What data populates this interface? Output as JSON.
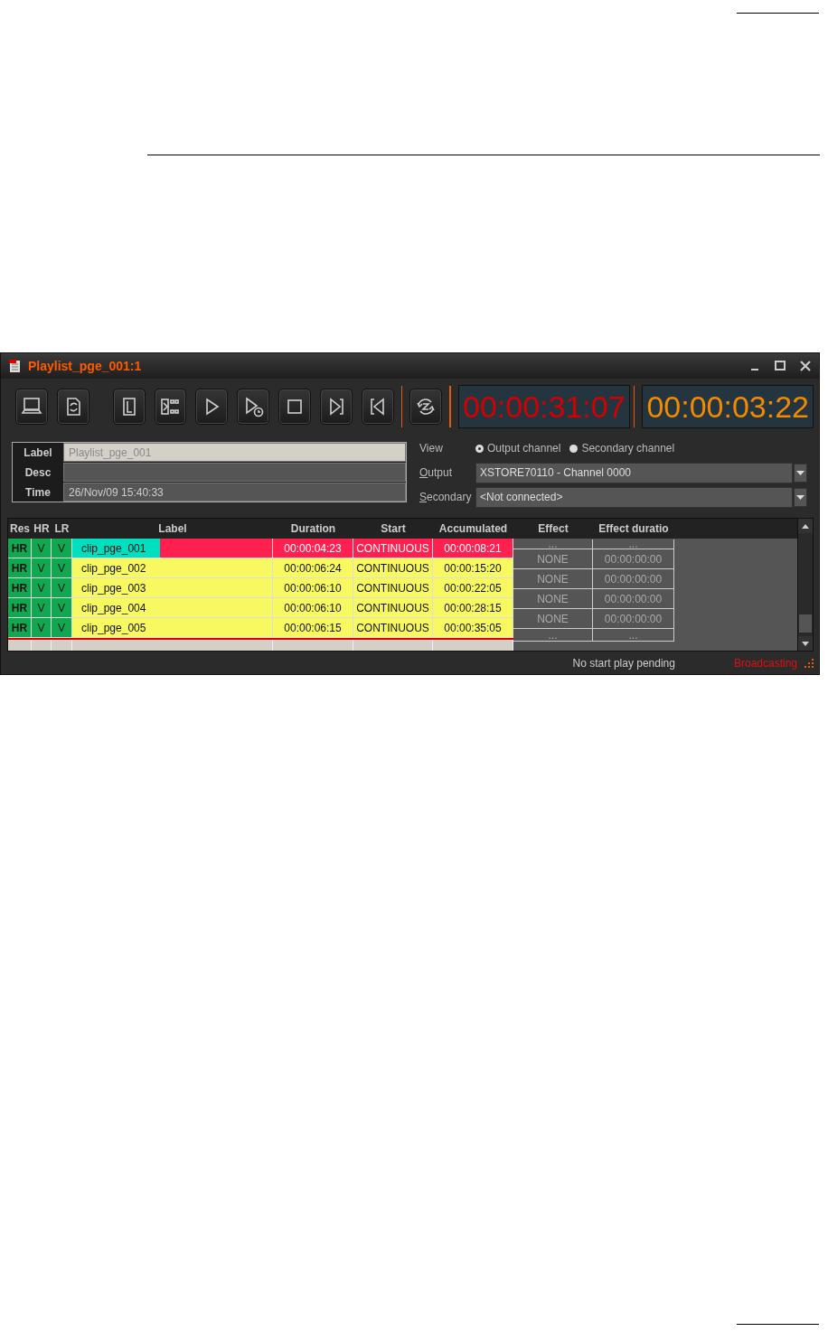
{
  "window": {
    "title": "Playlist_pge_001:1"
  },
  "timers": [
    {
      "text": "00:00:31:07",
      "color": "#d40000"
    },
    {
      "text": "00:00:03:22",
      "color": "#f08a00"
    }
  ],
  "info": [
    {
      "label": "Label",
      "value": "Playlist_pge_001",
      "editable": true
    },
    {
      "label": "Desc",
      "editable": false
    },
    {
      "label": "Time",
      "value": "26/Nov/09 15:40:33",
      "editable": false
    }
  ],
  "view": {
    "label": "View",
    "options": [
      {
        "label": "Output channel",
        "selected": true
      },
      {
        "label": "Secondary channel",
        "selected": false
      }
    ]
  },
  "output": {
    "label": "Output",
    "value": "XSTORE70110 - Channel 0000"
  },
  "secondary": {
    "label": "Secondary",
    "value": "<Not connected>"
  },
  "table": {
    "columns": [
      "Res",
      "HR",
      "LR",
      "Label",
      "Duration",
      "Start",
      "Accumulated",
      "Effect",
      "Effect duratio"
    ],
    "rows": [
      {
        "res": "HR",
        "hr": "V",
        "lr": "V",
        "label": "clip_pge_001",
        "duration": "00:00:04:23",
        "start": "CONTINUOUS",
        "accumulated": "00:00:08:21",
        "selected": true
      },
      {
        "res": "HR",
        "hr": "V",
        "lr": "V",
        "label": "clip_pge_002",
        "duration": "00:00:06:24",
        "start": "CONTINUOUS",
        "accumulated": "00:00:15:20",
        "selected": false
      },
      {
        "res": "HR",
        "hr": "V",
        "lr": "V",
        "label": "clip_pge_003",
        "duration": "00:00:06:10",
        "start": "CONTINUOUS",
        "accumulated": "00:00:22:05",
        "selected": false
      },
      {
        "res": "HR",
        "hr": "V",
        "lr": "V",
        "label": "clip_pge_004",
        "duration": "00:00:06:10",
        "start": "CONTINUOUS",
        "accumulated": "00:00:28:15",
        "selected": false
      },
      {
        "res": "HR",
        "hr": "V",
        "lr": "V",
        "label": "clip_pge_005",
        "duration": "00:00:06:15",
        "start": "CONTINUOUS",
        "accumulated": "00:00:35:05",
        "selected": false
      }
    ],
    "effects": [
      {
        "effect": "...",
        "duration": "..."
      },
      {
        "effect": "NONE",
        "duration": "00:00:00:00"
      },
      {
        "effect": "NONE",
        "duration": "00:00:00:00"
      },
      {
        "effect": "NONE",
        "duration": "00:00:00:00"
      },
      {
        "effect": "NONE",
        "duration": "00:00:00:00"
      },
      {
        "effect": "...",
        "duration": "..."
      }
    ]
  },
  "status_bar": {
    "message": "No start play pending",
    "state": "Broadcasting"
  }
}
